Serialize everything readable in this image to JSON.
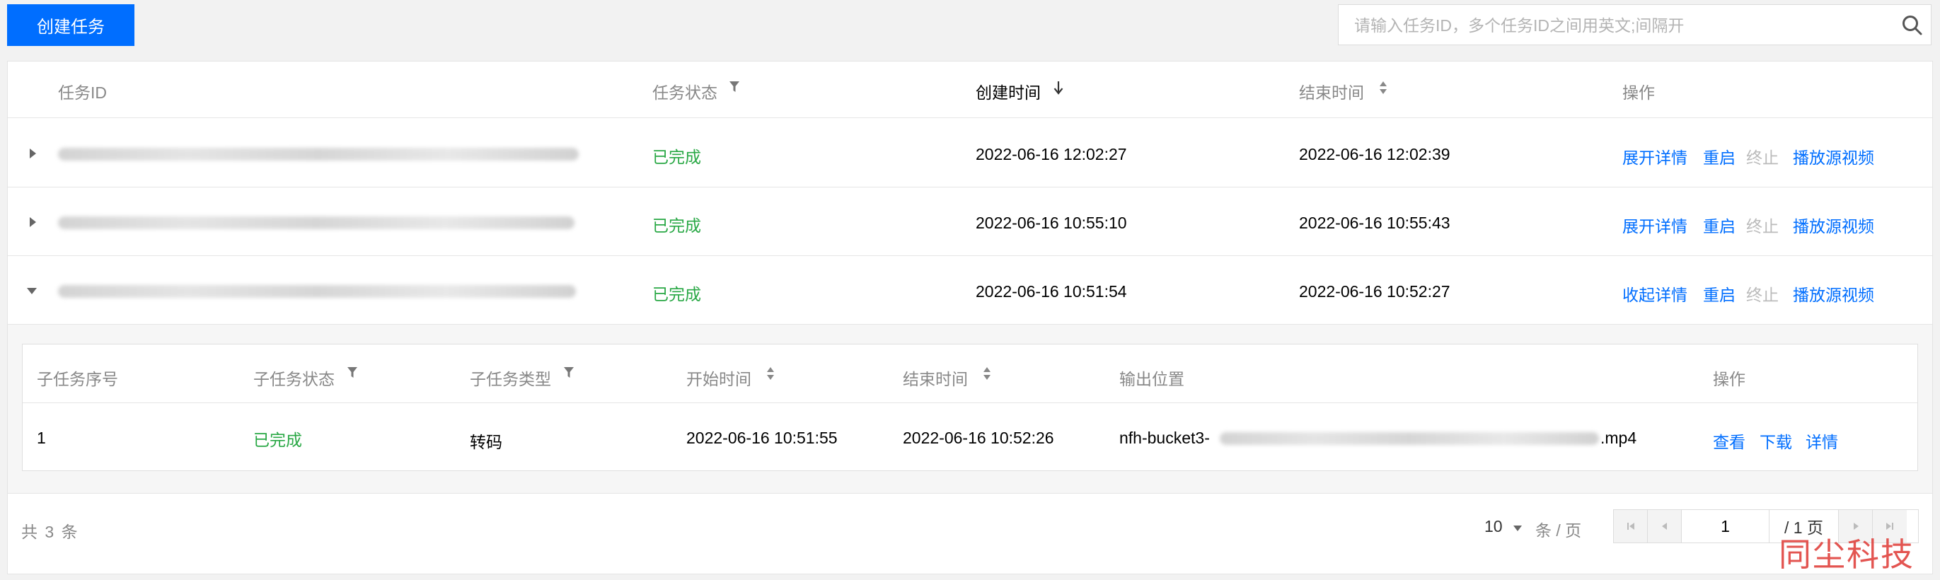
{
  "toolbar": {
    "create_label": "创建任务"
  },
  "search": {
    "placeholder": "请输入任务ID，多个任务ID之间用英文;间隔开",
    "value": ""
  },
  "table": {
    "headers": {
      "id": "任务ID",
      "status": "任务状态",
      "created": "创建时间",
      "ended": "结束时间",
      "actions": "操作"
    },
    "rows": [
      {
        "status": "已完成",
        "created": "2022-06-16 12:02:27",
        "ended": "2022-06-16 12:02:39",
        "detail": "展开详情",
        "restart": "重启",
        "stop": "终止",
        "play": "播放源视频"
      },
      {
        "status": "已完成",
        "created": "2022-06-16 10:55:10",
        "ended": "2022-06-16 10:55:43",
        "detail": "展开详情",
        "restart": "重启",
        "stop": "终止",
        "play": "播放源视频"
      },
      {
        "status": "已完成",
        "created": "2022-06-16 10:51:54",
        "ended": "2022-06-16 10:52:27",
        "detail": "收起详情",
        "restart": "重启",
        "stop": "终止",
        "play": "播放源视频"
      }
    ]
  },
  "subtable": {
    "headers": {
      "index": "子任务序号",
      "status": "子任务状态",
      "type": "子任务类型",
      "start": "开始时间",
      "end": "结束时间",
      "output": "输出位置",
      "actions": "操作"
    },
    "rows": [
      {
        "index": "1",
        "status": "已完成",
        "type": "转码",
        "start": "2022-06-16 10:51:55",
        "end": "2022-06-16 10:52:26",
        "output_prefix": "nfh-bucket3-",
        "output_suffix": ".mp4",
        "view": "查看",
        "download": "下载",
        "detail": "详情"
      }
    ]
  },
  "footer": {
    "total": "共 3 条",
    "page_size": "10",
    "page_size_unit": "条 / 页",
    "current_page": "1",
    "total_pages": "/ 1 页"
  },
  "watermark": "同尘科技",
  "icons": {
    "search": "search-icon",
    "filter": "filter-icon",
    "sort_desc": "sort-desc-icon",
    "sort": "sort-icon",
    "expand": "caret-right-icon",
    "collapse": "caret-down-icon",
    "dropdown": "caret-down-icon",
    "first": "first-page-icon",
    "prev": "prev-page-icon",
    "next": "next-page-icon",
    "last": "last-page-icon"
  },
  "colors": {
    "primary": "#006eff",
    "success": "#29a845",
    "disabled": "#bbbbbb",
    "watermark": "#e0433f"
  }
}
